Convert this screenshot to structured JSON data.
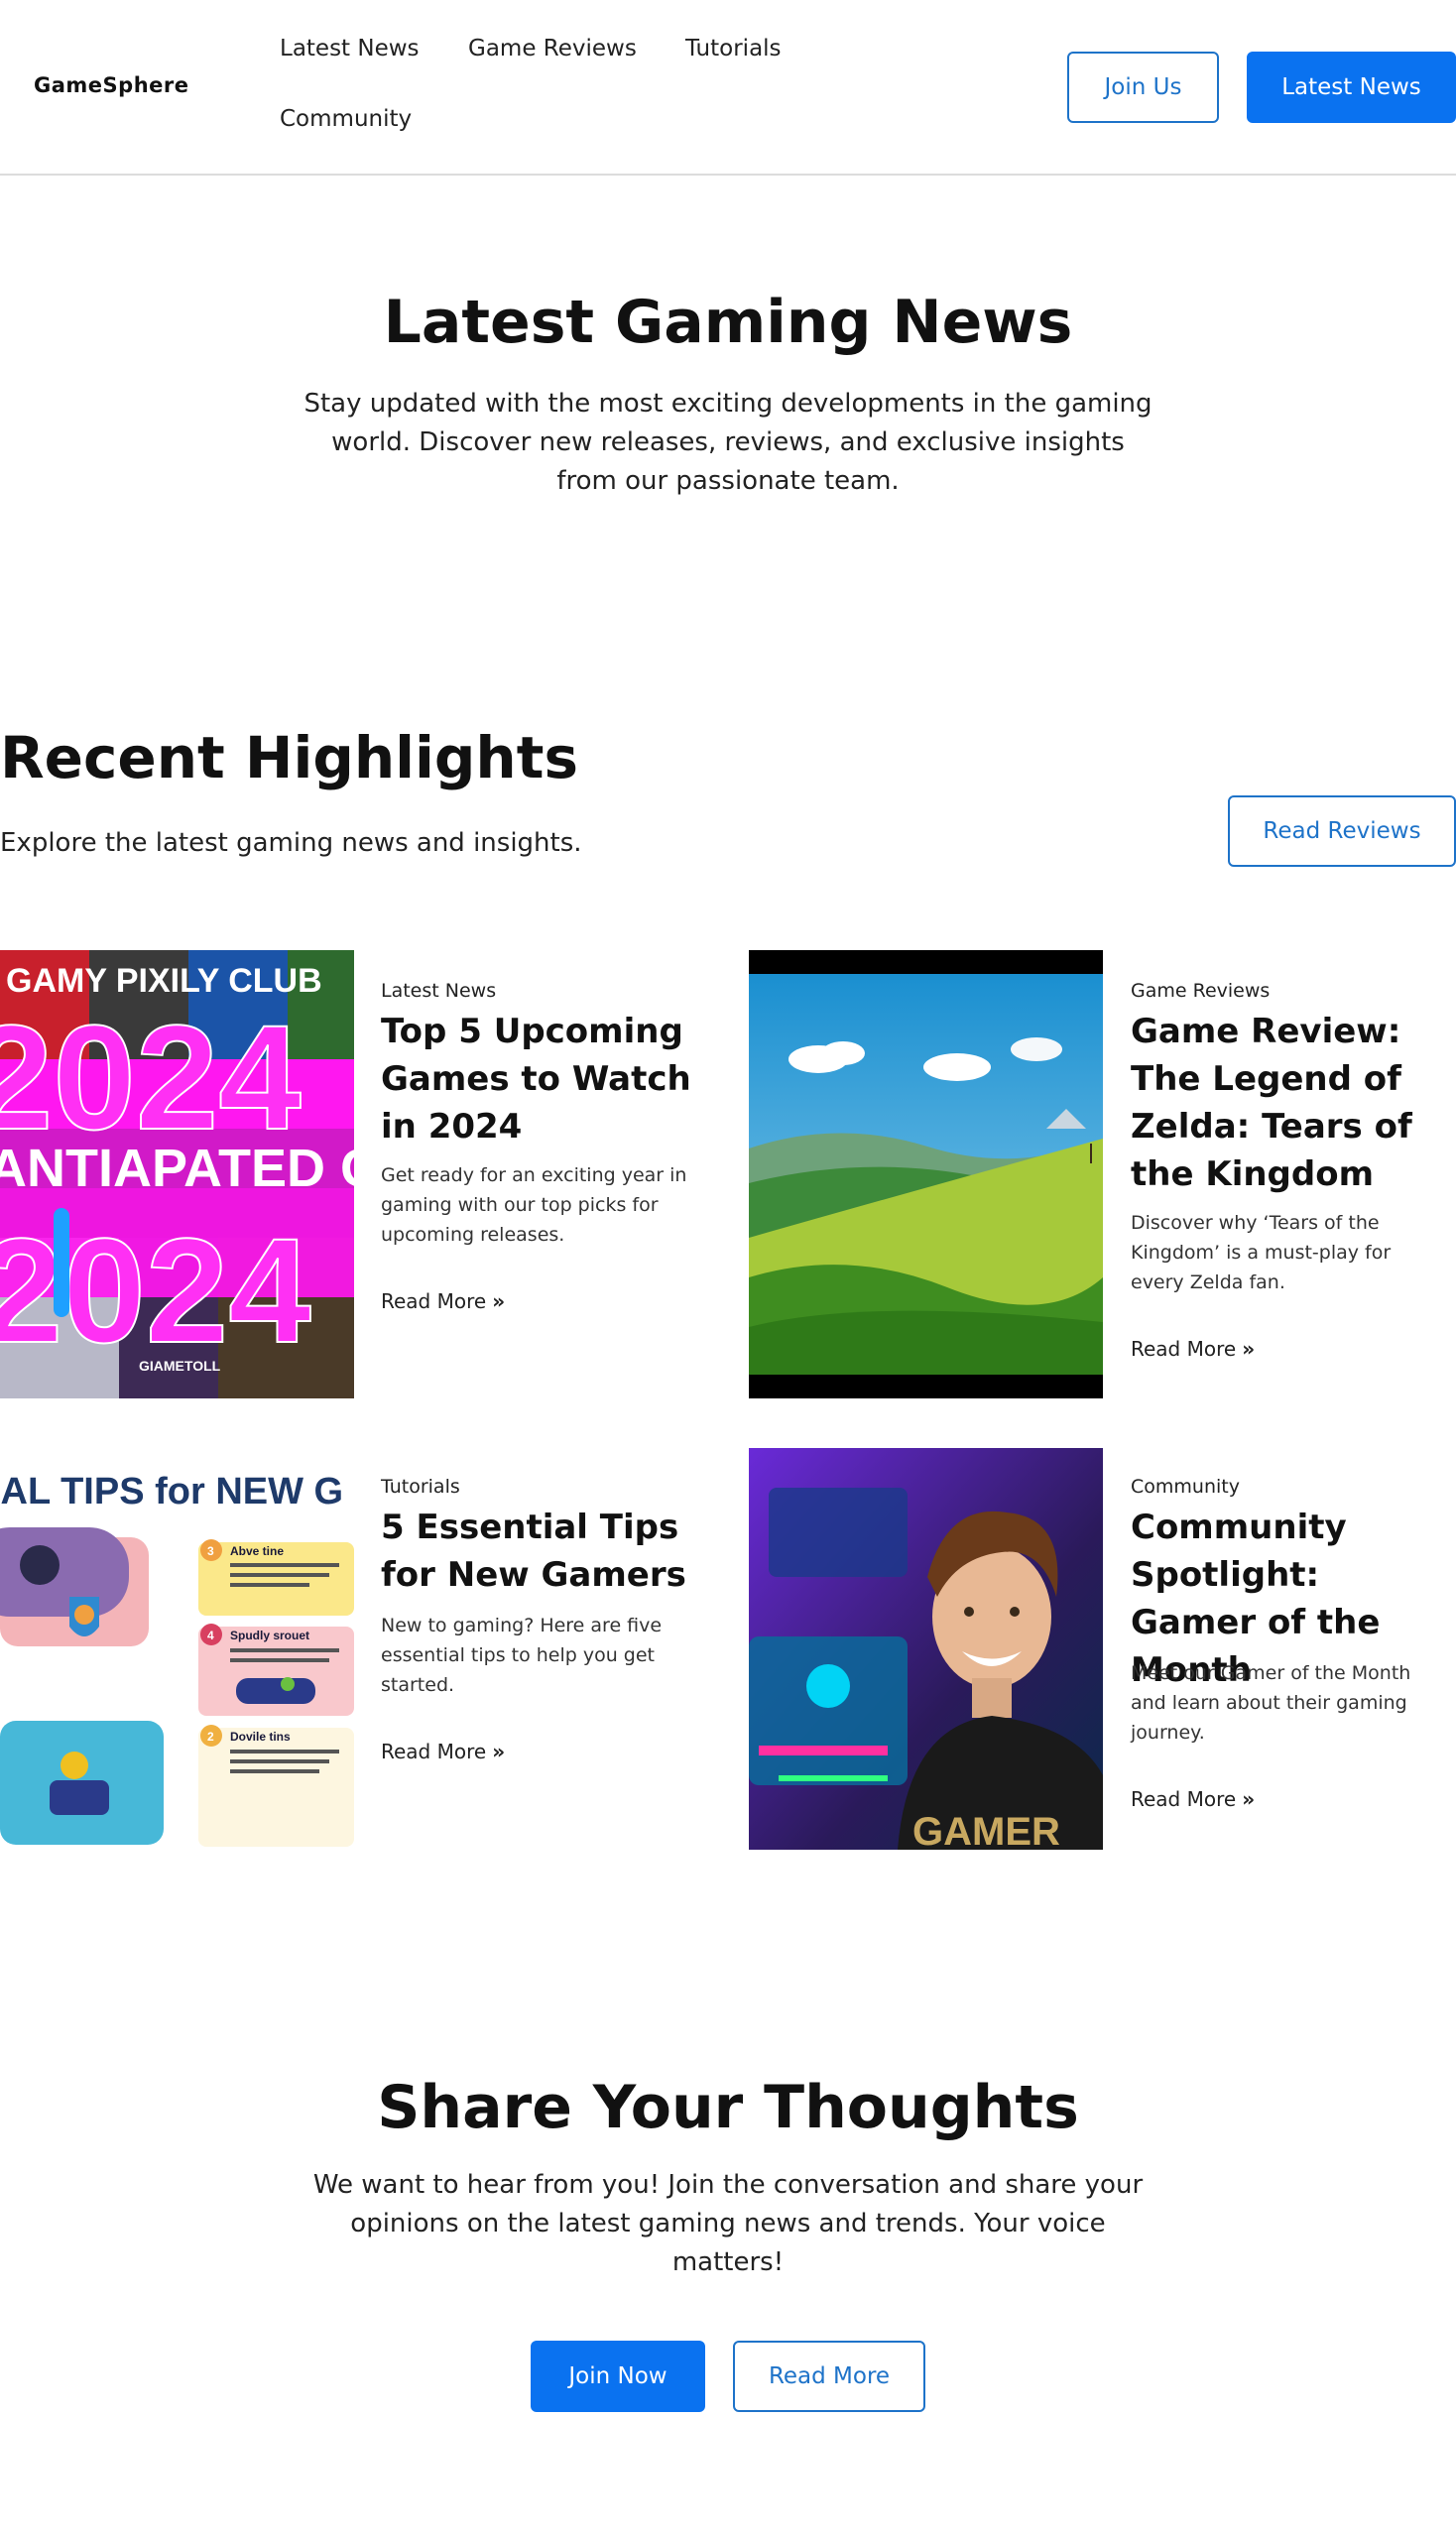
{
  "header": {
    "logo": "GameSphere",
    "nav": [
      "Latest News",
      "Game Reviews",
      "Tutorials",
      "Community"
    ],
    "join_label": "Join Us",
    "latest_label": "Latest News"
  },
  "hero": {
    "title": "Latest Gaming News",
    "text": "Stay updated with the most exciting developments in the gaming world. Discover new releases, reviews, and exclusive insights from our passionate team."
  },
  "highlights": {
    "title": "Recent Highlights",
    "subtitle": "Explore the latest gaming news and insights.",
    "reviews_label": "Read Reviews",
    "cards": [
      {
        "category": "Latest News",
        "title": "Top 5 Upcoming Games to Watch in 2024",
        "desc": "Get ready for an exciting year in gaming with our top picks for upcoming releases.",
        "link": "Read More",
        "image_text": [
          "GAMY PIXILY CLUB",
          "2024",
          "ANTIAPATED G",
          "2024",
          "GIAMETOLL"
        ]
      },
      {
        "category": "Game Reviews",
        "title": "Game Review: The Legend of Zelda: Tears of the Kingdom",
        "desc": "Discover why ‘Tears of the Kingdom’ is a must-play for every Zelda fan.",
        "link": "Read More"
      },
      {
        "category": "Tutorials",
        "title": "5 Essential Tips for New Gamers",
        "desc": "New to gaming? Here are five essential tips to help you get started.",
        "link": "Read More",
        "image_text": {
          "banner": "IAL TIPS for NEW G",
          "tips": [
            {
              "num": "3",
              "title": "Abve tine"
            },
            {
              "num": "4",
              "title": "Spudly srouet"
            },
            {
              "num": "2",
              "title": "Dovile tins"
            }
          ]
        }
      },
      {
        "category": "Community",
        "title": "Community Spotlight: Gamer of the Month",
        "desc": "Meet our Gamer of the Month and learn about their gaming journey.",
        "link": "Read More",
        "image_text": "GAMER"
      }
    ]
  },
  "share": {
    "title": "Share Your Thoughts",
    "text": "We want to hear from you! Join the conversation and share your opinions on the latest gaming news and trends. Your voice matters!",
    "join_label": "Join Now",
    "read_label": "Read More"
  },
  "colors": {
    "accent": "#0a72f0",
    "outline": "#1e73c9",
    "magenta": "#ff17f0"
  }
}
